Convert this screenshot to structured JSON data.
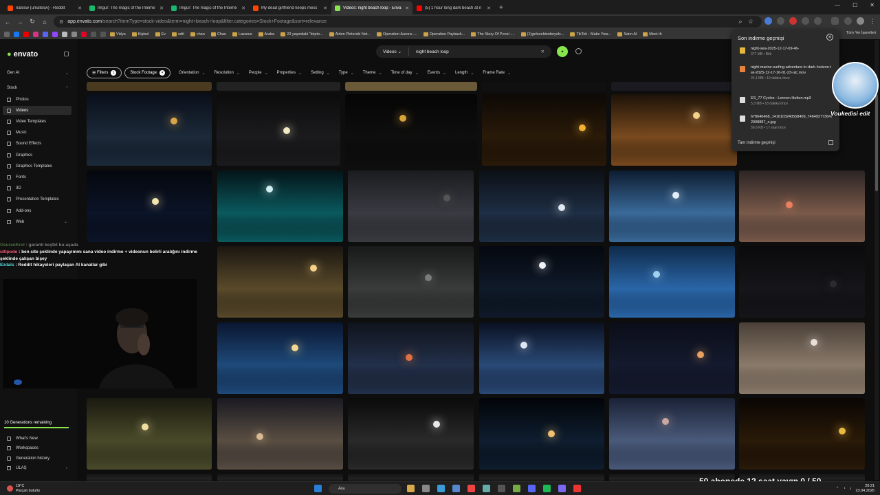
{
  "browser": {
    "tabs": [
      {
        "title": "natesw (u/natesw) - Reddit",
        "color": "#ff4500",
        "active": false
      },
      {
        "title": "Imgur: The magic of the Interne",
        "color": "#1bb76e",
        "active": false
      },
      {
        "title": "Imgur: The magic of the Interne",
        "color": "#1bb76e",
        "active": false
      },
      {
        "title": "My dead girlfriend keeps mess",
        "color": "#ff4500",
        "active": false
      },
      {
        "title": "Videos: night beach loop - Enva",
        "color": "#87e64b",
        "active": true
      },
      {
        "title": "(5) 1 hour long dark beach at n",
        "color": "#ff0000",
        "active": false
      }
    ],
    "new_tab": "+",
    "url_domain": "app.envato.com",
    "url_path": "/search?itemType=stock-video&term=night+beach+loop&filter.categories=Stock+Footage&sort=relevance",
    "bookmarks": [
      "Vidya",
      "Kişisel",
      "Ev",
      "edit",
      "chan",
      "Chao",
      "Lazarus",
      "Araba",
      "23 yaşındaki \"kripto...",
      "Aiden Pleterski Net...",
      "Operation Aurora -...",
      "Operation Payback...",
      "The Story Of Ponzi -...",
      "(1)gelecektenbeyolc...",
      "TikTok - Make Your...",
      "Satın Al",
      "Meet th"
    ],
    "bookmarks_right": "Tüm Yer İşaretleri"
  },
  "sidebar": {
    "logo": "envato",
    "gen_ai": "Gen AI",
    "stock": "Stock",
    "items": [
      {
        "label": "Photos",
        "active": false
      },
      {
        "label": "Videos",
        "active": true
      },
      {
        "label": "Video Templates",
        "active": false
      },
      {
        "label": "Music",
        "active": false
      },
      {
        "label": "Sound Effects",
        "active": false
      },
      {
        "label": "Graphics",
        "active": false
      },
      {
        "label": "Graphics Templates",
        "active": false
      },
      {
        "label": "Fonts",
        "active": false
      },
      {
        "label": "3D",
        "active": false
      },
      {
        "label": "Presentation Templates",
        "active": false
      },
      {
        "label": "Add-ons",
        "active": false
      },
      {
        "label": "Web",
        "active": false
      }
    ],
    "generations": "10 Generations remaining",
    "bottom": [
      "What's New",
      "Workspaces",
      "Generation history",
      "ULAŞ"
    ]
  },
  "search": {
    "category": "Videos",
    "query": "night beach loop"
  },
  "filters": {
    "filters_label": "Filters",
    "filters_count": "1",
    "stock_footage": "Stock Footage",
    "dropdowns": [
      "Orientation",
      "Resolution",
      "People",
      "Properties",
      "Setting",
      "Type",
      "Theme",
      "Time of day",
      "Events",
      "Length",
      "Frame Rate"
    ]
  },
  "downloads": {
    "title": "Son indirme geçmişi",
    "items": [
      {
        "name": "night-sea-2025-12-17-09-46-",
        "meta": "377 MB • Bitti",
        "color": "#e6b73a"
      },
      {
        "name": "night-marine-surfing-adventure-in-dark-horizon-twi-2025-12-17-16-01-23-utc.mov",
        "meta": "24,1 MB • 10 dakika önce",
        "color": "#e8813a"
      },
      {
        "name": "ES_77 Cycles - Lennon Hutton.mp3",
        "meta": "5,3 MB • 18 dakika önce",
        "color": "#dddddd"
      },
      {
        "name": "678646468_1416103240558409_7464927736472908887_n.jpg",
        "meta": "59,6 KB • 17 saat önce",
        "color": "#dddddd"
      }
    ],
    "all": "Tam indirme geçmişi"
  },
  "chat": [
    {
      "user": "OsuranKrol",
      "text": "garanti keşfet bu aşada",
      "color": "#9be07b",
      "dim": true
    },
    {
      "user": "ultipode",
      "text": "ben site şeklinde yapayımmı sana video indirme + videonun belirli aralığını indirme şeklinde çalışan bişey",
      "color": "#ff5f7a",
      "dim": false
    },
    {
      "user": "Ezdals",
      "text": "Reddit hikayeleri paylaşan AI kanallar gibi",
      "color": "#5be3e8",
      "dim": false
    }
  ],
  "overlay": {
    "avatar_name": "Voukedisi edit",
    "subs_text": "50 abonede 12 saat yayın 0 / 50"
  },
  "taskbar": {
    "temp": "18°C",
    "weather": "Parçalı bulutlu",
    "search": "Ara",
    "time": "20:21",
    "date": "23.04.2026"
  }
}
